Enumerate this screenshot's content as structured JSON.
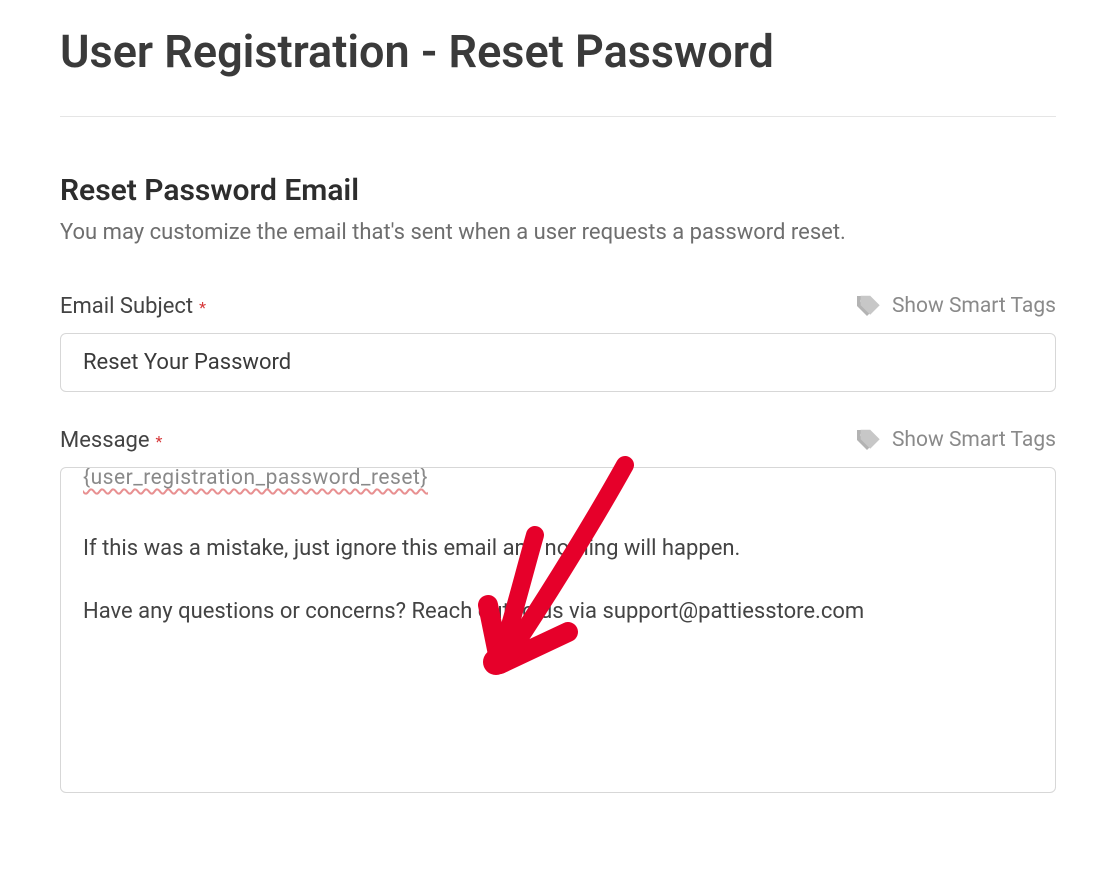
{
  "header": {
    "title": "User Registration - Reset Password"
  },
  "section": {
    "title": "Reset Password Email",
    "desc": "You may customize the email that's sent when a user requests a password reset."
  },
  "smartTags": {
    "label": "Show Smart Tags"
  },
  "fields": {
    "subject": {
      "label": "Email Subject",
      "required": "*",
      "value": "Reset Your Password"
    },
    "message": {
      "label": "Message",
      "required": "*",
      "squiggle": "{user_registration_password_reset}",
      "para1": "If this was a mistake, just ignore this email and nothing will happen.",
      "para2": "Have any questions or concerns? Reach out to us via support@pattiesstore.com"
    }
  }
}
